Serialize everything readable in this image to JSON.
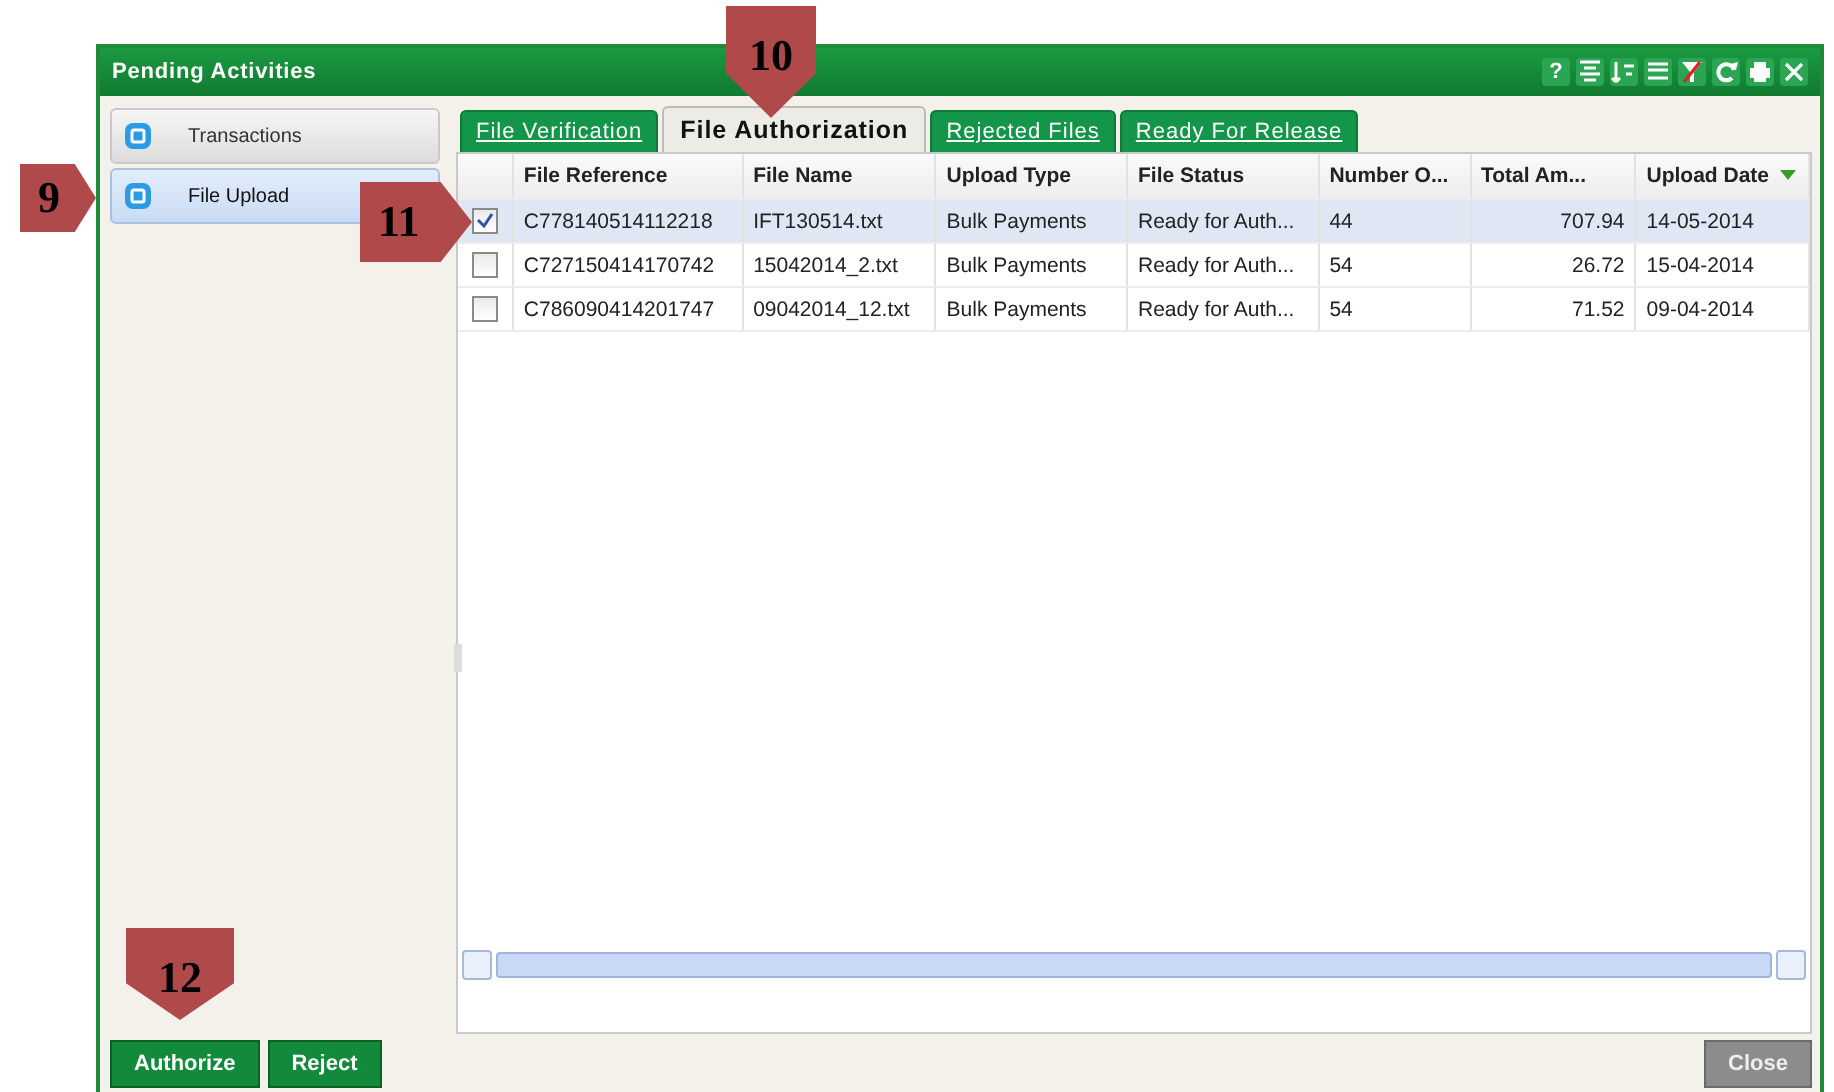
{
  "window": {
    "title": "Pending Activities",
    "help": "?"
  },
  "sidebar": {
    "items": [
      {
        "label": "Transactions",
        "selected": false
      },
      {
        "label": "File Upload",
        "selected": true
      }
    ]
  },
  "tabs": [
    {
      "label": "File Verification",
      "selected": false
    },
    {
      "label": "File Authorization",
      "selected": true
    },
    {
      "label": "Rejected Files",
      "selected": false
    },
    {
      "label": "Ready For Release",
      "selected": false
    }
  ],
  "table": {
    "columns": [
      {
        "label": "File Reference",
        "kind": "text",
        "sorted": false
      },
      {
        "label": "File Name",
        "kind": "text",
        "sorted": false
      },
      {
        "label": "Upload Type",
        "kind": "text",
        "sorted": false
      },
      {
        "label": "File Status",
        "kind": "text",
        "sorted": false
      },
      {
        "label": "Number O...",
        "kind": "text",
        "sorted": false
      },
      {
        "label": "Total Am...",
        "kind": "number",
        "sorted": false
      },
      {
        "label": "Upload Date",
        "kind": "text",
        "sorted": true
      }
    ],
    "rows": [
      {
        "checked": true,
        "selected": true,
        "cells": [
          "C778140514112218",
          "IFT130514.txt",
          "Bulk Payments",
          "Ready for Auth...",
          "44",
          "707.94",
          "14-05-2014"
        ]
      },
      {
        "checked": false,
        "selected": false,
        "cells": [
          "C727150414170742",
          "15042014_2.txt",
          "Bulk Payments",
          "Ready for Auth...",
          "54",
          "26.72",
          "15-04-2014"
        ]
      },
      {
        "checked": false,
        "selected": false,
        "cells": [
          "C786090414201747",
          "09042014_12.txt",
          "Bulk Payments",
          "Ready for Auth...",
          "54",
          "71.52",
          "09-04-2014"
        ]
      }
    ]
  },
  "buttons": [
    {
      "label": "Authorize",
      "disabled": false
    },
    {
      "label": "Reject",
      "disabled": false
    },
    {
      "label": "Close",
      "disabled": true
    }
  ],
  "callouts": [
    {
      "label": "9",
      "kind": "right"
    },
    {
      "label": "10",
      "kind": "down"
    },
    {
      "label": "11",
      "kind": "right"
    },
    {
      "label": "12",
      "kind": "down"
    }
  ]
}
